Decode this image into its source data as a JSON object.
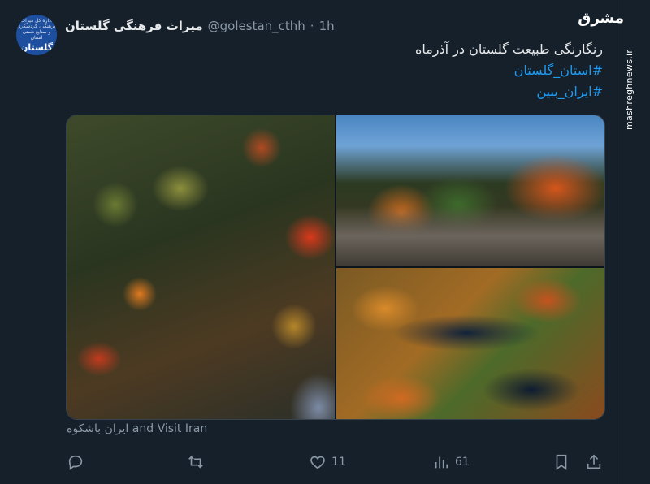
{
  "account": {
    "display_name": "میراث فرهنگی گلستان",
    "handle": "@golestan_cthh",
    "separator": "·",
    "time": "1h",
    "avatar_text_small": "اداره کل میراث فرهنگی، گردشگری و صنایع دستی استان",
    "avatar_text_big": "گلستان"
  },
  "tweet": {
    "line1": "رنگارنگی طبیعت گلستان در آذرماه",
    "hashtag1": "#استان_گلستان",
    "hashtag2": "#ایران_ببین"
  },
  "media": {
    "caption": "ایران باشکوه and Visit Iran"
  },
  "actions": {
    "replies": "",
    "retweets": "",
    "likes": "11",
    "views": "61"
  },
  "watermark": {
    "logo": "مشرق",
    "url": "mashreghnews.ir"
  },
  "colors": {
    "background": "#15202b",
    "text": "#e7e9ea",
    "muted": "#8b98a5",
    "accent": "#1d9bf0"
  }
}
